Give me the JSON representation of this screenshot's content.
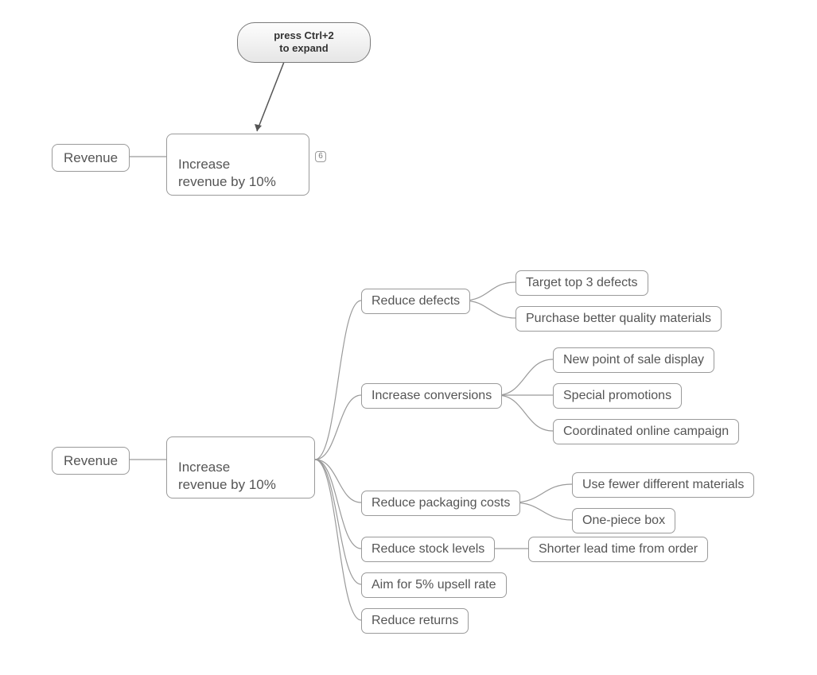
{
  "tooltip": {
    "line1": "press Ctrl+2",
    "line2": "to expand"
  },
  "top": {
    "root": "Revenue",
    "child": "Increase\nrevenue by 10%",
    "badge": "6"
  },
  "bottom": {
    "root": "Revenue",
    "child": "Increase\nrevenue by 10%",
    "branches": [
      {
        "label": "Reduce defects",
        "children": [
          "Target top 3 defects",
          "Purchase better quality materials"
        ]
      },
      {
        "label": "Increase conversions",
        "children": [
          "New  point of sale display",
          "Special promotions",
          "Coordinated online campaign"
        ]
      },
      {
        "label": "Reduce packaging costs",
        "children": [
          "Use fewer different materials",
          "One-piece box"
        ]
      },
      {
        "label": "Reduce stock levels",
        "children": [
          "Shorter lead time from order"
        ]
      },
      {
        "label": "Aim for 5% upsell rate",
        "children": []
      },
      {
        "label": "Reduce returns",
        "children": []
      }
    ]
  }
}
